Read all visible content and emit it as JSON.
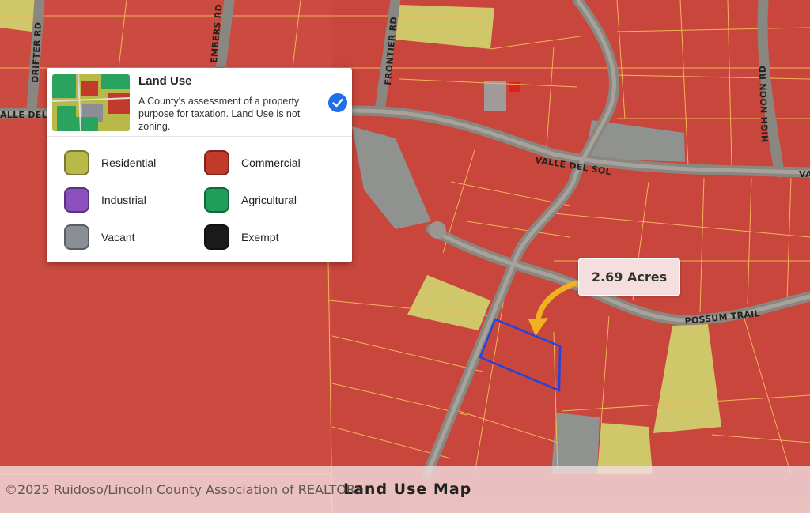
{
  "legend": {
    "title": "Land Use",
    "description": "A County's assessment of a property purpose for taxation. Land Use is not zoning.",
    "selected": true,
    "items": [
      {
        "label": "Residential",
        "color": "#b9b94a"
      },
      {
        "label": "Commercial",
        "color": "#c23a2a"
      },
      {
        "label": "Industrial",
        "color": "#8b4fc0"
      },
      {
        "label": "Agricultural",
        "color": "#1f9e5a"
      },
      {
        "label": "Vacant",
        "color": "#8a8f96"
      },
      {
        "label": "Exempt",
        "color": "#1a1a1a"
      }
    ]
  },
  "map": {
    "roads": [
      "DRIFTER RD",
      "ALLE DEL SO",
      "EMBERS RD",
      "FRONTIER RD",
      "HIGH NOON RD",
      "VALLE DEL SOL",
      "VA",
      "POSSUM TRAIL"
    ],
    "callout": "2.69 Acres",
    "colors": {
      "commercial_overlay": "#d0463b",
      "residential_overlay": "#c9c66a",
      "vacant_overlay": "#8f928f",
      "parcel_lines": "#f2b458",
      "subject_outline": "#2244dd",
      "arrow": "#f0b020"
    }
  },
  "footer": {
    "title": "Land Use Map",
    "copyright": "©2025 Ruidoso/Lincoln County Association of REALTORS"
  }
}
